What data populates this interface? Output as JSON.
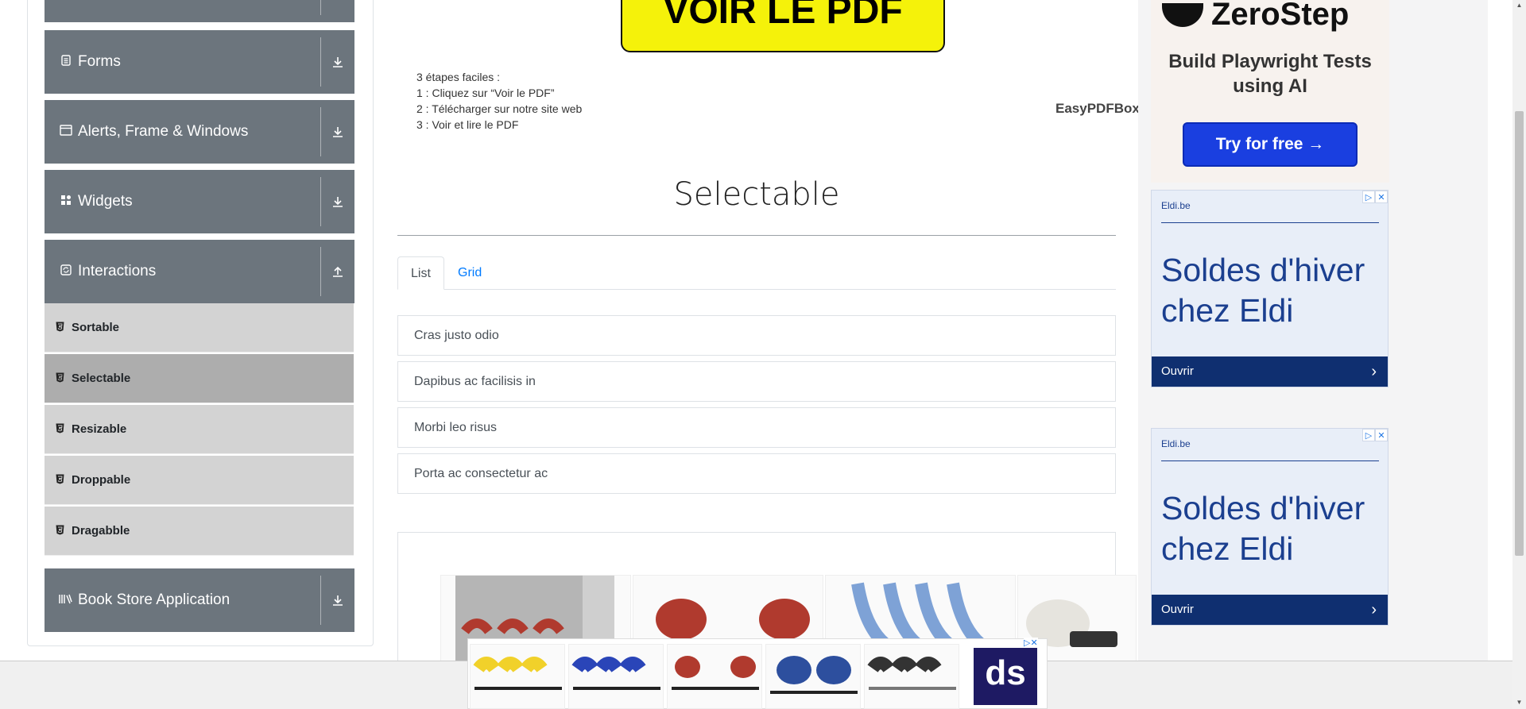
{
  "sidebar": {
    "groups": [
      {
        "label": "",
        "icon": "collapsed-group-icon"
      },
      {
        "label": "Forms",
        "icon": "document-icon"
      },
      {
        "label": "Alerts, Frame & Windows",
        "icon": "window-icon"
      },
      {
        "label": "Widgets",
        "icon": "grid-icon"
      },
      {
        "label": "Interactions",
        "icon": "refresh-icon",
        "expanded": true
      },
      {
        "label": "Book Store Application",
        "icon": "books-icon"
      }
    ],
    "interaction_items": [
      {
        "label": "Sortable",
        "active": false
      },
      {
        "label": "Selectable",
        "active": true
      },
      {
        "label": "Resizable",
        "active": false
      },
      {
        "label": "Droppable",
        "active": false
      },
      {
        "label": "Dragabble",
        "active": false
      }
    ]
  },
  "pdf_ad": {
    "button": "VOIR LE PDF",
    "steps": [
      "3 étapes faciles :",
      "1 : Cliquez sur “Voir le PDF”",
      "2 : Télécharger sur notre site web",
      "3 : Voir et lire le PDF"
    ],
    "brand": "EasyPDFBox"
  },
  "main": {
    "title": "Selectable",
    "tabs": [
      {
        "label": "List",
        "active": true
      },
      {
        "label": "Grid",
        "active": false
      }
    ],
    "list_items": [
      "Cras justo odio",
      "Dapibus ac facilisis in",
      "Morbi leo risus",
      "Porta ac consectetur ac"
    ]
  },
  "right_ads": {
    "zerostep": {
      "brand": "ZeroStep",
      "headline": "Build Playwright Tests using AI",
      "cta": "Try for free →"
    },
    "eldi": [
      {
        "site": "Eldi.be",
        "headline": "Soldes d'hiver chez Eldi",
        "cta": "Ouvrir"
      },
      {
        "site": "Eldi.be",
        "headline": "Soldes d'hiver chez Eldi",
        "cta": "Ouvrir"
      }
    ]
  },
  "bottom_ad": {
    "logo": "ds"
  },
  "colors": {
    "sidebar_group": "#6c757d",
    "sidebar_item": "#d3d3d3",
    "sidebar_active": "#adadad",
    "link": "#007bff",
    "pdf_yellow": "#f5f20a",
    "zs_button": "#1a3fe0",
    "eldi_blue": "#1b3f8f"
  }
}
